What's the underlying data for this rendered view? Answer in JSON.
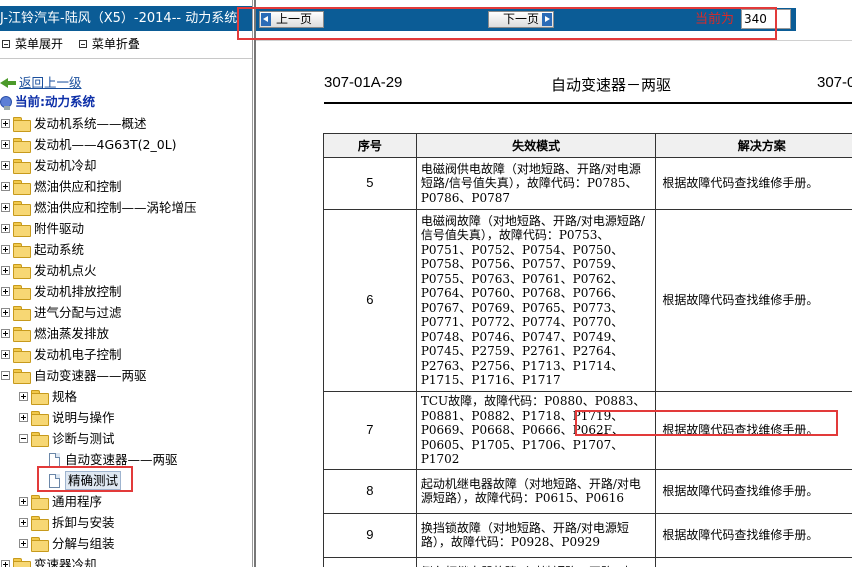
{
  "left_panel": {
    "title": "J-江铃汽车-陆风（X5）-2014-- 动力系统",
    "menu": {
      "expand": "菜单展开",
      "collapse": "菜单折叠"
    },
    "back_link": "返回上一级",
    "current": "当前:动力系统",
    "tree": [
      {
        "label": "发动机系统——概述",
        "level": 0,
        "state": "plus",
        "icon": "folder-icon"
      },
      {
        "label": "发动机——4G63T(2_0L)",
        "level": 0,
        "state": "plus",
        "icon": "folder-icon"
      },
      {
        "label": "发动机冷却",
        "level": 0,
        "state": "plus",
        "icon": "folder-icon"
      },
      {
        "label": "燃油供应和控制",
        "level": 0,
        "state": "plus",
        "icon": "folder-icon"
      },
      {
        "label": "燃油供应和控制——涡轮增压",
        "level": 0,
        "state": "plus",
        "icon": "folder-icon"
      },
      {
        "label": "附件驱动",
        "level": 0,
        "state": "plus",
        "icon": "folder-icon"
      },
      {
        "label": "起动系统",
        "level": 0,
        "state": "plus",
        "icon": "folder-icon"
      },
      {
        "label": "发动机点火",
        "level": 0,
        "state": "plus",
        "icon": "folder-icon"
      },
      {
        "label": "发动机排放控制",
        "level": 0,
        "state": "plus",
        "icon": "folder-icon"
      },
      {
        "label": "进气分配与过滤",
        "level": 0,
        "state": "plus",
        "icon": "folder-icon"
      },
      {
        "label": "燃油蒸发排放",
        "level": 0,
        "state": "plus",
        "icon": "folder-icon"
      },
      {
        "label": "发动机电子控制",
        "level": 0,
        "state": "plus",
        "icon": "folder-icon"
      },
      {
        "label": "自动变速器——两驱",
        "level": 0,
        "state": "minus",
        "icon": "folder-icon"
      },
      {
        "label": "规格",
        "level": 1,
        "state": "plus",
        "icon": "folder-icon"
      },
      {
        "label": "说明与操作",
        "level": 1,
        "state": "plus",
        "icon": "folder-icon"
      },
      {
        "label": "诊断与测试",
        "level": 1,
        "state": "minus",
        "icon": "folder-icon"
      },
      {
        "label": "自动变速器——两驱",
        "level": 2,
        "state": "none",
        "icon": "document-icon"
      },
      {
        "label": "精确测试",
        "level": 2,
        "state": "none",
        "icon": "document-icon",
        "selected": true
      },
      {
        "label": "通用程序",
        "level": 1,
        "state": "plus",
        "icon": "folder-icon"
      },
      {
        "label": "拆卸与安装",
        "level": 1,
        "state": "plus",
        "icon": "folder-icon"
      },
      {
        "label": "分解与组装",
        "level": 1,
        "state": "plus",
        "icon": "folder-icon"
      },
      {
        "label": "变速器冷却",
        "level": 0,
        "state": "plus",
        "icon": "folder-icon"
      }
    ]
  },
  "toolbar": {
    "prev_label": "上一页",
    "next_label": "下一页",
    "current_page_label": "当前为",
    "current_page_value": "340"
  },
  "document": {
    "header_left": "307-01A-29",
    "header_title": "自动变速器－两驱",
    "header_right": "307-0",
    "columns": [
      "序号",
      "失效模式",
      "解决方案"
    ],
    "rows": [
      {
        "no": "5",
        "failure": "电磁阀供电故障（对地短路、开路/对电源短路/信号值失真），故障代码：P0785、P0786、P0787",
        "solution": "根据故障代码查找维修手册。"
      },
      {
        "no": "6",
        "failure": "电磁阀故障（对地短路、开路/对电源短路/信号值失真），故障代码：P0753、P0751、P0752、P0754、P0750、P0758、P0756、P0757、P0759、P0755、P0763、P0761、P0762、P0764、P0760、P0768、P0766、P0767、P0769、P0765、P0773、P0771、P0772、P0774、P0770、P0748、P0746、P0747、P0749、P0745、P2759、P2761、P2764、P2763、P2756、P1713、P1714、P1715、P1716、P1717",
        "solution": "根据故障代码查找维修手册。"
      },
      {
        "no": "7",
        "failure": "TCU故障，故障代码：P0880、P0883、P0881、P0882、P1718、P1719、P0669、P0668、P0666、P062F、P0605、P1705、P1706、P1707、P1702",
        "solution": "根据故障代码查找维修手册。"
      },
      {
        "no": "8",
        "failure": "起动机继电器故障（对地短路、开路/对电源短路），故障代码：P0615、P0616",
        "solution": "根据故障代码查找维修手册。"
      },
      {
        "no": "9",
        "failure": "换挡锁故障（对地短路、开路/对电源短路），故障代码：P0928、P0929",
        "solution": "根据故障代码查找维修手册。"
      },
      {
        "no": "",
        "failure": "倒车灯继电器故障（对地短路、开路/对",
        "solution": ""
      }
    ]
  },
  "colors": {
    "title_bar": "#0b5c96",
    "highlight_box": "#e23a3a",
    "current_page_label": "#d42a2a",
    "link": "#1a4f9c"
  }
}
